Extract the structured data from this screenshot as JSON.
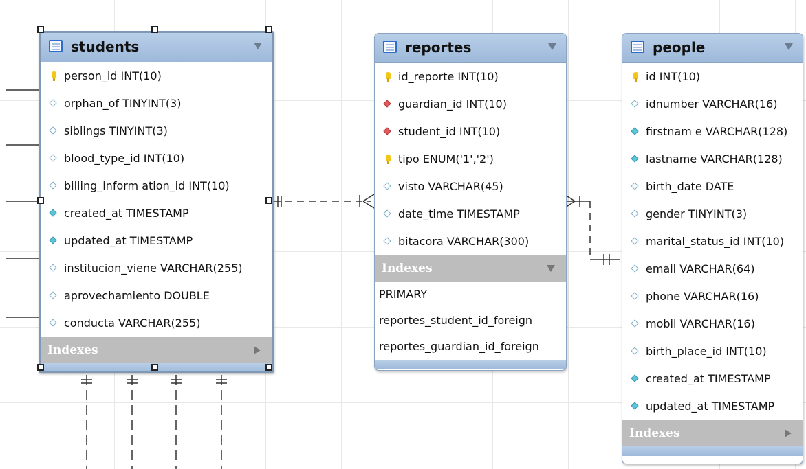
{
  "tables": {
    "students": {
      "title": "students",
      "columns": [
        {
          "text": "person_id INT(10)",
          "icon": "primary-key-icon"
        },
        {
          "text": "orphan_of TINYINT(3)",
          "icon": "nullable-column-icon"
        },
        {
          "text": "siblings TINYINT(3)",
          "icon": "nullable-column-icon"
        },
        {
          "text": "blood_type_id INT(10)",
          "icon": "nullable-column-icon"
        },
        {
          "text": "billing_inform ation_id INT(10)",
          "icon": "nullable-column-icon"
        },
        {
          "text": "created_at TIMESTAMP",
          "icon": "column-icon"
        },
        {
          "text": "updated_at TIMESTAMP",
          "icon": "column-icon"
        },
        {
          "text": "institucion_viene VARCHAR(255)",
          "icon": "nullable-column-icon"
        },
        {
          "text": "aprovechamiento DOUBLE",
          "icon": "nullable-column-icon"
        },
        {
          "text": "conducta VARCHAR(255)",
          "icon": "nullable-column-icon"
        }
      ],
      "indexes_label": "Indexes"
    },
    "reportes": {
      "title": "reportes",
      "columns": [
        {
          "text": "id_reporte INT(10)",
          "icon": "primary-key-icon"
        },
        {
          "text": "guardian_id INT(10)",
          "icon": "foreign-key-icon"
        },
        {
          "text": "student_id INT(10)",
          "icon": "foreign-key-icon"
        },
        {
          "text": "tipo ENUM('1','2')",
          "icon": "primary-key-icon"
        },
        {
          "text": "visto VARCHAR(45)",
          "icon": "nullable-column-icon"
        },
        {
          "text": "date_time TIMESTAMP",
          "icon": "nullable-column-icon"
        },
        {
          "text": "bitacora VARCHAR(300)",
          "icon": "nullable-column-icon"
        }
      ],
      "indexes_label": "Indexes",
      "indexes": [
        "PRIMARY",
        "reportes_student_id_foreign",
        "reportes_guardian_id_foreign"
      ]
    },
    "people": {
      "title": "people",
      "columns": [
        {
          "text": "id INT(10)",
          "icon": "primary-key-icon"
        },
        {
          "text": "idnumber VARCHAR(16)",
          "icon": "nullable-column-icon"
        },
        {
          "text": "firstnam e VARCHAR(128)",
          "icon": "column-icon"
        },
        {
          "text": "lastname VARCHAR(128)",
          "icon": "column-icon"
        },
        {
          "text": "birth_date DATE",
          "icon": "nullable-column-icon"
        },
        {
          "text": "gender TINYINT(3)",
          "icon": "nullable-column-icon"
        },
        {
          "text": "marital_status_id INT(10)",
          "icon": "nullable-column-icon"
        },
        {
          "text": "email VARCHAR(64)",
          "icon": "nullable-column-icon"
        },
        {
          "text": "phone VARCHAR(16)",
          "icon": "nullable-column-icon"
        },
        {
          "text": "mobil VARCHAR(16)",
          "icon": "nullable-column-icon"
        },
        {
          "text": "birth_place_id INT(10)",
          "icon": "nullable-column-icon"
        },
        {
          "text": "created_at TIMESTAMP",
          "icon": "column-icon"
        },
        {
          "text": "updated_at TIMESTAMP",
          "icon": "column-icon"
        }
      ],
      "indexes_label": "Indexes"
    }
  },
  "colors": {
    "header": "#a9c3e3",
    "indexes_bar": "#bdbdbd",
    "key": "#f3c719",
    "foreign_key": "#e05c5c",
    "column": "#5ec4d8"
  }
}
